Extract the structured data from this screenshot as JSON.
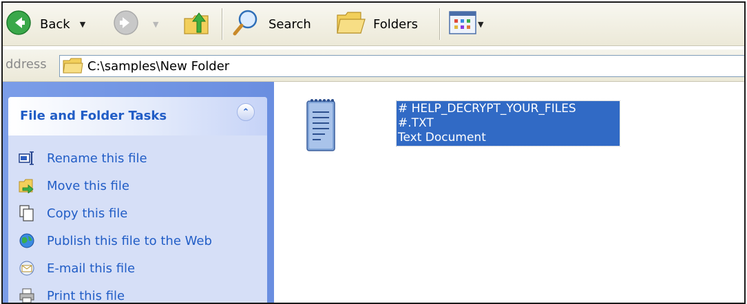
{
  "toolbar": {
    "back_label": "Back",
    "search_label": "Search",
    "folders_label": "Folders"
  },
  "address": {
    "label": "ddress",
    "value": "C:\\samples\\New Folder"
  },
  "task_panel": {
    "title": "File and Folder Tasks",
    "items": [
      {
        "label": "Rename this file",
        "icon": "rename-icon"
      },
      {
        "label": "Move this file",
        "icon": "move-icon"
      },
      {
        "label": "Copy this file",
        "icon": "copy-icon"
      },
      {
        "label": "Publish this file to the Web",
        "icon": "publish-web-icon"
      },
      {
        "label": "E-mail this file",
        "icon": "email-icon"
      },
      {
        "label": "Print this file",
        "icon": "print-icon"
      }
    ]
  },
  "file": {
    "name_line1": "# HELP_DECRYPT_YOUR_FILES",
    "name_line2": "#.TXT",
    "type": "Text Document"
  },
  "colors": {
    "task_link": "#215dc6",
    "selection": "#316ac5",
    "task_pane_bg": "#6a8ee0"
  }
}
